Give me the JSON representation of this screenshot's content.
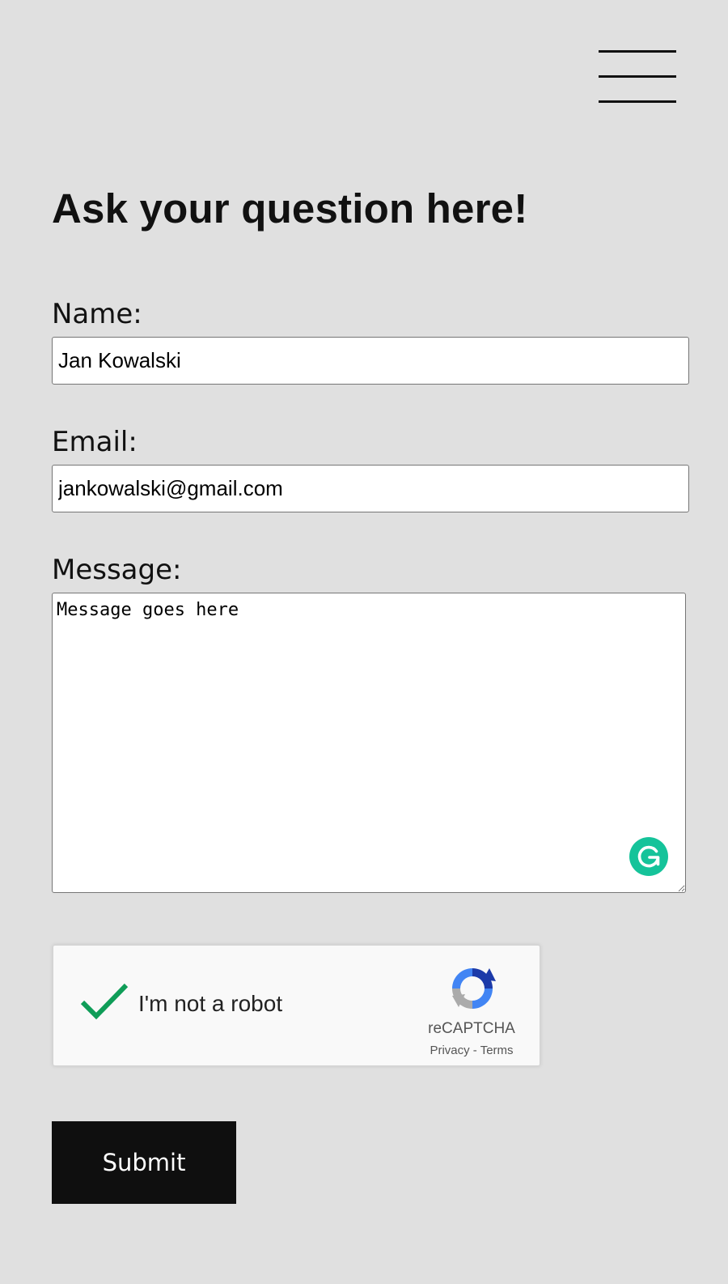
{
  "header": {
    "menu_icon": "hamburger-menu-icon"
  },
  "form": {
    "title": "Ask your question here!",
    "name_label": "Name:",
    "name_value": "Jan Kowalski",
    "email_label": "Email:",
    "email_value": "jankowalski@gmail.com",
    "message_label": "Message:",
    "message_value": "Message goes here",
    "grammarly_icon": "grammarly-icon",
    "submit_label": "Submit"
  },
  "recaptcha": {
    "label": "I'm not a robot",
    "checked": true,
    "brand": "reCAPTCHA",
    "privacy": "Privacy",
    "separator": " - ",
    "terms": "Terms",
    "check_color": "#0f9d58",
    "logo_icon": "recaptcha-logo-icon"
  },
  "colors": {
    "background": "#e0e0e0",
    "button": "#0f0f0f",
    "grammarly": "#15c39a"
  }
}
